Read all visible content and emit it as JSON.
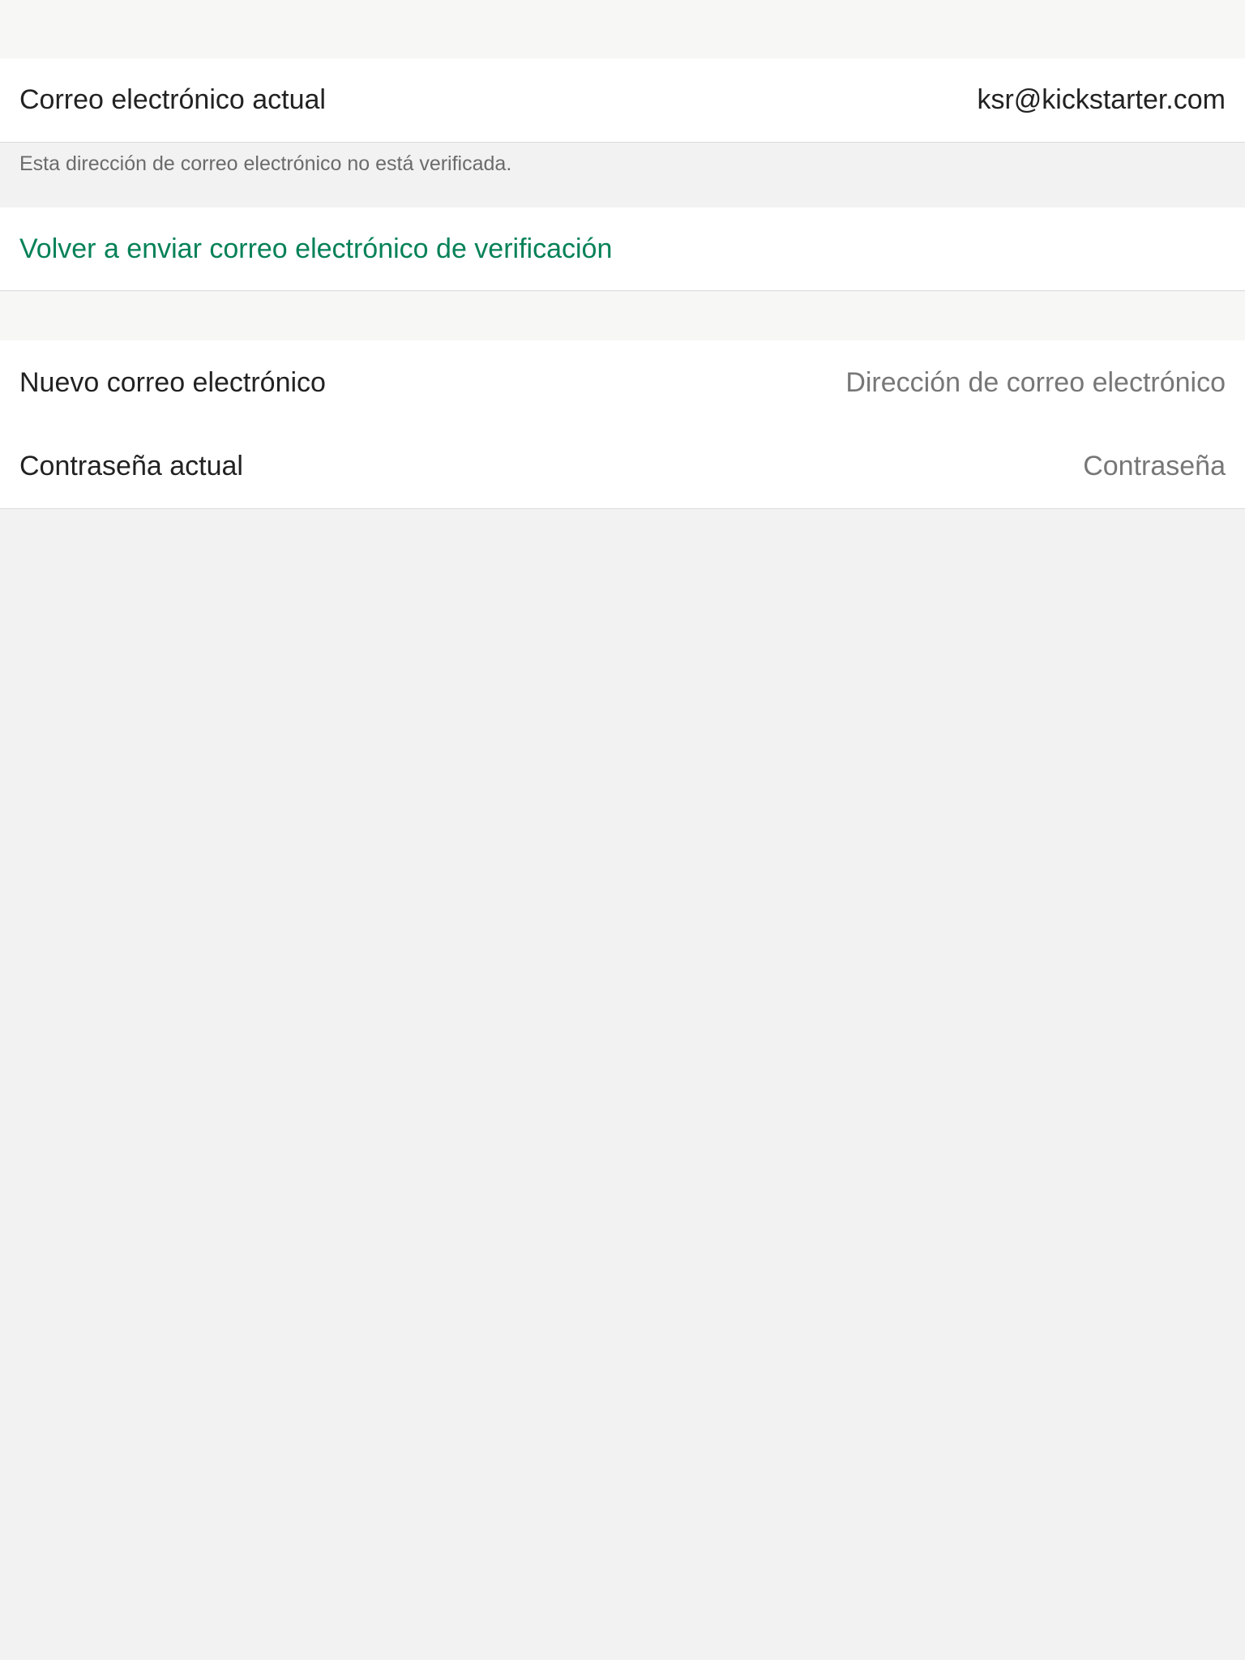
{
  "current_email": {
    "label": "Correo electrónico actual",
    "value": "ksr@kickstarter.com",
    "note": "Esta dirección de correo electrónico no está verificada."
  },
  "resend": {
    "label": "Volver a enviar correo electrónico de verificación"
  },
  "new_email": {
    "label": "Nuevo correo electrónico",
    "placeholder": "Dirección de correo electrónico",
    "value": ""
  },
  "password": {
    "label": "Contraseña actual",
    "placeholder": "Contraseña",
    "value": ""
  },
  "colors": {
    "accent": "#058158",
    "background": "#f2f2f2",
    "cell": "#ffffff"
  }
}
